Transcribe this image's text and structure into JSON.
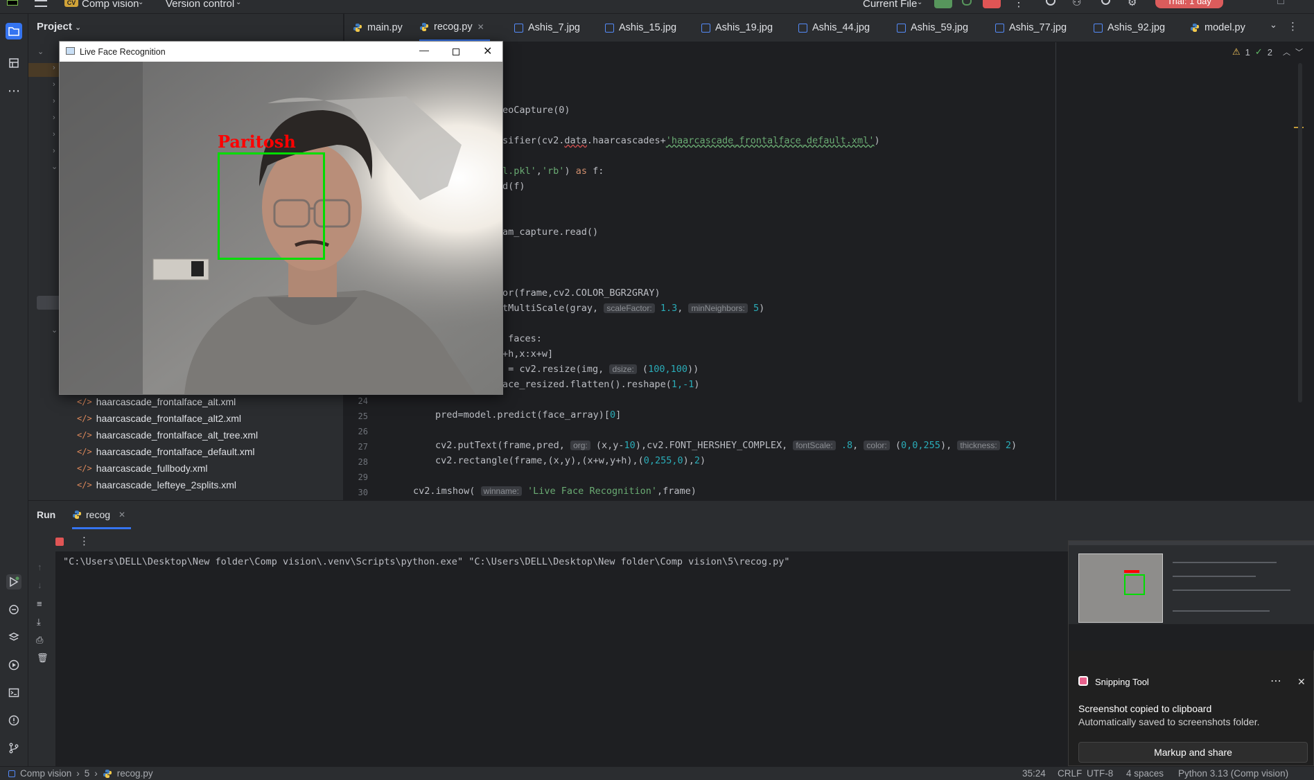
{
  "topbar": {
    "project_name": "Comp vision",
    "vcs": "Version control",
    "run_config": "Current File",
    "trial_badge": "Trial: 1 day",
    "project_initials": "CV"
  },
  "project_panel": {
    "title": "Project",
    "files": [
      "haarcascade_frontalface_alt.xml",
      "haarcascade_frontalface_alt2.xml",
      "haarcascade_frontalface_alt_tree.xml",
      "haarcascade_frontalface_default.xml",
      "haarcascade_fullbody.xml",
      "haarcascade_lefteye_2splits.xml"
    ]
  },
  "tabs": [
    {
      "label": "main.py",
      "type": "py"
    },
    {
      "label": "recog.py",
      "type": "py",
      "active": true
    },
    {
      "label": "Ashis_7.jpg",
      "type": "img"
    },
    {
      "label": "Ashis_15.jpg",
      "type": "img"
    },
    {
      "label": "Ashis_19.jpg",
      "type": "img"
    },
    {
      "label": "Ashis_44.jpg",
      "type": "img"
    },
    {
      "label": "Ashis_59.jpg",
      "type": "img"
    },
    {
      "label": "Ashis_77.jpg",
      "type": "img"
    },
    {
      "label": "Ashis_92.jpg",
      "type": "img"
    },
    {
      "label": "model.py",
      "type": "py"
    }
  ],
  "inspections": {
    "warnings": "1",
    "ok": "2"
  },
  "code": {
    "l1": "eoCapture(0)",
    "l2a": "sifier(cv2.",
    "l2b": "data",
    "l2c": ".haarcascades+",
    "l2d": "'haarcascade_frontalface_default.xml'",
    "l2e": ")",
    "l3a": "l.pkl'",
    "l3b": ",",
    "l3c": "'rb'",
    "l3d": ") ",
    "l3e": "as",
    "l3f": " f:",
    "l4": "d(f)",
    "l5": "am_capture.read()",
    "l6": "or(frame,cv2.COLOR_BGR2GRAY)",
    "l7a": "tMultiScale(gray, ",
    "l7h1": "scaleFactor:",
    "l7v1": "1.3",
    "l7b": ", ",
    "l7h2": "minNeighbors:",
    "l7v2": "5",
    "l7c": ")",
    "l8": " faces:",
    "l9": "+h,x:x+w]",
    "l10a": " = cv2.resize(img, ",
    "l10h": "dsize:",
    "l10b": " (",
    "l10v": "100,100",
    "l10c": "))",
    "l11a": "ace_resized.flatten().reshape(",
    "l11v": "1,-1",
    "l11b": ")",
    "l25a": "pred=model.predict(face_array)[",
    "l25v": "0",
    "l25b": "]",
    "l27a": "cv2.putText(frame,pred, ",
    "l27h1": "org:",
    "l27b": " (x,y-",
    "l27v1": "10",
    "l27c": "),cv2.FONT_HERSHEY_COMPLEX, ",
    "l27h2": "fontScale:",
    "l27v2": " .8",
    "l27d": ", ",
    "l27h3": "color:",
    "l27e": " (",
    "l27v3": "0,0,255",
    "l27f": "), ",
    "l27h4": "thickness:",
    "l27v4": " 2",
    "l27g": ")",
    "l28a": "cv2.rectangle(frame,(x,y),(x+w,y+h),(",
    "l28v": "0,255,0",
    "l28b": "),",
    "l28v2": "2",
    "l28c": ")",
    "l30a": "cv2.imshow( ",
    "l30h": "winname:",
    "l30s": " 'Live Face Recognition'",
    "l30b": ",frame)",
    "line_numbers": [
      "24",
      "25",
      "26",
      "27",
      "28",
      "29",
      "30"
    ]
  },
  "run": {
    "tab_run": "Run",
    "tab_recog": "recog",
    "command": "\"C:\\Users\\DELL\\Desktop\\New folder\\Comp vision\\.venv\\Scripts\\python.exe\" \"C:\\Users\\DELL\\Desktop\\New folder\\Comp vision\\5\\recog.py\""
  },
  "status": {
    "crumb1": "Comp vision",
    "crumb2": "5",
    "crumb3": "recog.py",
    "position": "35:24",
    "line_sep": "CRLF",
    "encoding": "UTF-8",
    "indent": "4 spaces",
    "interpreter": "Python 3.13 (Comp vision)"
  },
  "live_window": {
    "title": "Live Face Recognition",
    "label": "Paritosh",
    "label_color": "#ff0000",
    "box_color": "#00dd00"
  },
  "snipping": {
    "app": "Snipping Tool",
    "heading": "Screenshot copied to clipboard",
    "body": "Automatically saved to screenshots folder.",
    "button": "Markup and share"
  },
  "colors": {
    "accent": "#3574f0",
    "stop_red": "#e05555",
    "run_green": "#57965c",
    "trial_badge": "#db5c5c"
  }
}
